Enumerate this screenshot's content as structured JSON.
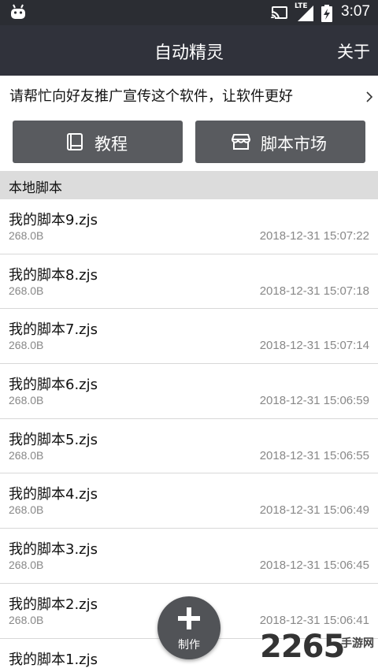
{
  "status_bar": {
    "network": "LTE",
    "time": "3:07"
  },
  "app_bar": {
    "title": "自动精灵",
    "about_label": "关于"
  },
  "promo": {
    "text": "请帮忙向好友推广宣传这个软件，让软件更好"
  },
  "buttons": {
    "tutorial_label": "教程",
    "market_label": "脚本市场"
  },
  "section": {
    "title": "本地脚本"
  },
  "scripts": [
    {
      "name": "我的脚本9.zjs",
      "size": "268.0B",
      "date": "2018-12-31 15:07:22"
    },
    {
      "name": "我的脚本8.zjs",
      "size": "268.0B",
      "date": "2018-12-31 15:07:18"
    },
    {
      "name": "我的脚本7.zjs",
      "size": "268.0B",
      "date": "2018-12-31 15:07:14"
    },
    {
      "name": "我的脚本6.zjs",
      "size": "268.0B",
      "date": "2018-12-31 15:06:59"
    },
    {
      "name": "我的脚本5.zjs",
      "size": "268.0B",
      "date": "2018-12-31 15:06:55"
    },
    {
      "name": "我的脚本4.zjs",
      "size": "268.0B",
      "date": "2018-12-31 15:06:49"
    },
    {
      "name": "我的脚本3.zjs",
      "size": "268.0B",
      "date": "2018-12-31 15:06:45"
    },
    {
      "name": "我的脚本2.zjs",
      "size": "268.0B",
      "date": "2018-12-31 15:06:41"
    },
    {
      "name": "我的脚本1.zjs",
      "size": "",
      "date": ""
    }
  ],
  "fab": {
    "label": "制作"
  },
  "watermark": {
    "number": "2265",
    "site": "手游网"
  },
  "colors": {
    "app_bar": "#30323b",
    "status_bar": "#2b2d33",
    "button": "#595b5f",
    "section": "#dcdcdc",
    "fab": "#515357"
  }
}
